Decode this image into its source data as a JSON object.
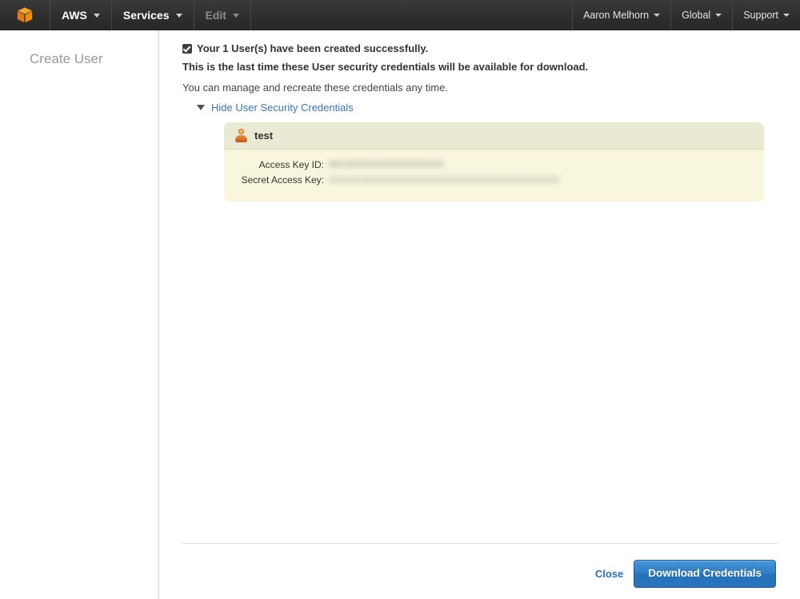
{
  "navbar": {
    "logo_icon": "aws-cube-icon",
    "left_items": [
      {
        "label": "AWS",
        "enabled": true,
        "has_caret": true
      },
      {
        "label": "Services",
        "enabled": true,
        "has_caret": true
      },
      {
        "label": "Edit",
        "enabled": false,
        "has_caret": true
      }
    ],
    "right_items": [
      {
        "label": "Aaron Melhorn",
        "has_caret": true
      },
      {
        "label": "Global",
        "has_caret": true
      },
      {
        "label": "Support",
        "has_caret": true
      }
    ]
  },
  "sidebar": {
    "title": "Create User"
  },
  "main": {
    "success_line1": "Your 1 User(s) have been created successfully.",
    "success_line2": "This is the last time these User security credentials will be available for download.",
    "info_line": "You can manage and recreate these credentials any time.",
    "toggle_label": "Hide User Security Credentials",
    "toggle_icon": "triangle-down-icon",
    "checkbox_icon": "checkbox-checked-icon"
  },
  "credentials_panel": {
    "user_icon": "user-icon",
    "user_name": "test",
    "rows": [
      {
        "label": "Access Key ID:",
        "value": "AKIAXXXXXXXXXXXXXXXX",
        "masked": true
      },
      {
        "label": "Secret Access Key:",
        "value": "xxxxxxxxxxxxxxxxxxxxxxxxxxxxxxxxxxxxxxxx",
        "masked": true
      }
    ]
  },
  "footer": {
    "close_label": "Close",
    "download_label": "Download Credentials"
  },
  "colors": {
    "navbar_bg": "#2e2e2e",
    "aws_orange": "#f19000",
    "link_blue": "#3b73b9",
    "button_blue": "#2f7dc4",
    "panel_head_bg": "#eae9d4",
    "panel_body_bg": "#f8f7dd"
  }
}
